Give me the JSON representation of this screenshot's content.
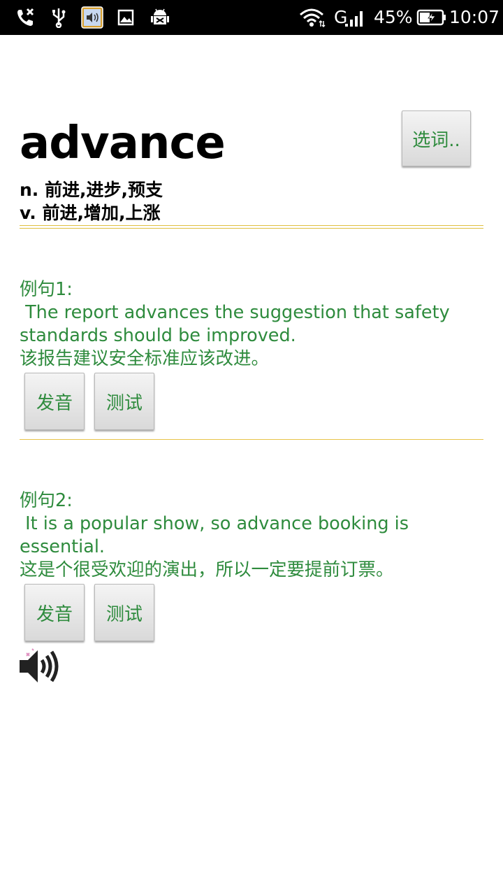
{
  "status_bar": {
    "battery": "45%",
    "time": "10:07",
    "network": "G",
    "icons": [
      "missed-call-icon",
      "usb-icon",
      "sound-app-icon",
      "image-icon",
      "android-debug-icon",
      "wifi-icon",
      "signal-icon",
      "battery-charging-icon"
    ]
  },
  "word": {
    "headword": "advance",
    "select_label": "选词..",
    "definitions": [
      "n. 前进,进步,预支",
      "v. 前进,增加,上涨"
    ]
  },
  "examples": [
    {
      "label": "例句1:",
      "english_line1": " The report advances the suggestion that safety",
      "english_line2": "standards should be improved.",
      "chinese": "该报告建议安全标准应该改进。",
      "pronounce_label": "发音",
      "test_label": "测试"
    },
    {
      "label": "例句2:",
      "english_line1": " It is a popular show, so advance booking is",
      "english_line2": "essential.",
      "chinese": "这是个很受欢迎的演出，所以一定要提前订票。",
      "pronounce_label": "发音",
      "test_label": "测试"
    }
  ],
  "colors": {
    "accent_green": "#2e8b3d",
    "divider_yellow": "#e0c040",
    "status_bar_bg": "#000000"
  }
}
